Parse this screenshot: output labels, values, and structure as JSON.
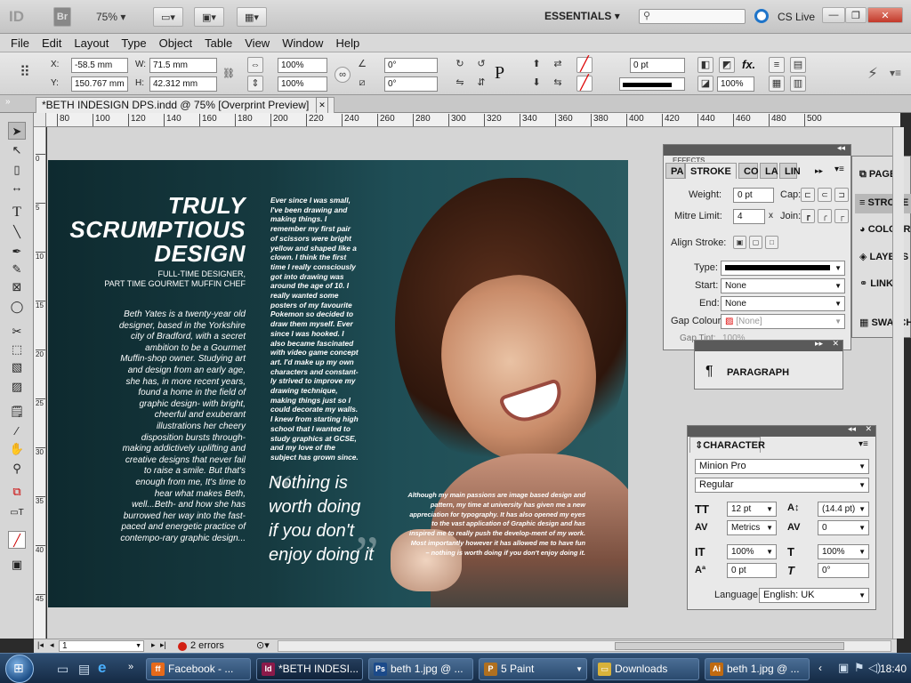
{
  "app": {
    "logo": "ID",
    "bridge": "Br",
    "zoom": "75%",
    "workspace": "ESSENTIALS",
    "cs_live": "CS Live"
  },
  "menu": [
    "File",
    "Edit",
    "Layout",
    "Type",
    "Object",
    "Table",
    "View",
    "Window",
    "Help"
  ],
  "control": {
    "x_label": "X:",
    "x_value": "-58.5 mm",
    "y_label": "Y:",
    "y_value": "150.767 mm",
    "w_label": "W:",
    "w_value": "71.5 mm",
    "h_label": "H:",
    "h_value": "42.312 mm",
    "scale_x": "100%",
    "scale_y": "100%",
    "angle1": "0°",
    "angle2": "0°",
    "stroke_weight": "0 pt",
    "opacity": "100%"
  },
  "doc_tab": "*BETH INDESIGN DPS.indd @ 75% [Overprint Preview]",
  "ruler_labels": [
    "80",
    "100",
    "120",
    "140",
    "160",
    "180",
    "200",
    "220",
    "240",
    "260",
    "280",
    "300",
    "320",
    "340",
    "360",
    "380",
    "400",
    "420",
    "440",
    "460",
    "480",
    "500"
  ],
  "vruler_labels": [
    "0",
    "5",
    "10",
    "15",
    "20",
    "25",
    "30",
    "35",
    "40",
    "45"
  ],
  "spread": {
    "title_lines": [
      "TRULY",
      "SCRUMPTIOUS",
      "DESIGN"
    ],
    "subtitle_lines": [
      "FULL-TIME DESIGNER,",
      "PART TIME GOURMET MUFFIN CHEF"
    ],
    "intro": "Beth Yates is a twenty-year old designer, based in the Yorkshire city of Bradford, with a secret ambition to be a Gourmet Muffin-shop owner. Studying art and design from an early age, she has, in more recent years, found a home in the field of graphic design- with bright, cheerful and exuberant illustrations her cheery disposition bursts through- making addictively uplifting and creative designs that never fail to raise a smile. But that's enough from me, It's time to hear what makes Beth, well...Beth- and how she has burrowed her way into the fast-paced and energetic practice of contempo-rary graphic design...",
    "column": "Ever since I was small, I've been drawing and making things. I remember my first pair of scissors were bright yellow and shaped like a clown. I think the first time I really consciously got into drawing was around the age of 10. I really wanted some posters of my favourite Pokemon so decided to draw them myself. Ever since I was hooked. I also became fascinated with video game concept art. I'd make up my own characters and constant-ly strived to improve my drawing technique, making things just so I could decorate my walls. I knew from starting high school that I wanted to study graphics at GCSE, and my love of the subject has grown since.",
    "quote_lines": [
      "Nothing is",
      "worth doing",
      "if you don't",
      "enjoy doing it"
    ],
    "caption": "Although my main passions are image based design and pattern, my time at university has given me a new appreciation for typography. It has also opened my eyes to the vast application of Graphic design and has inspired me to really push the develop-ment of my work. Most importantly however it has allowed me to have fun – nothing is worth doing if you don't enjoy doing it."
  },
  "stroke_panel": {
    "tabs": [
      "PA",
      "STROKE",
      "CO",
      "LA",
      "LIN"
    ],
    "effects_tab": "EFFECTS",
    "weight_label": "Weight:",
    "weight": "0 pt",
    "cap_label": "Cap:",
    "mitre_label": "Mitre Limit:",
    "mitre": "4",
    "x": "x",
    "join_label": "Join:",
    "align_label": "Align Stroke:",
    "type_label": "Type:",
    "start_label": "Start:",
    "start": "None",
    "end_label": "End:",
    "end": "None",
    "gap_colour_label": "Gap Colour:",
    "gap_colour": "[None]",
    "gap_tint_label": "Gap Tint:",
    "gap_tint": "100%"
  },
  "dock": [
    "PAGES",
    "STROKE",
    "COLOUR",
    "LAYERS",
    "LINKS",
    "SWATCHES"
  ],
  "paragraph_panel": {
    "title": "PARAGRAPH"
  },
  "character_panel": {
    "title": "CHARACTER",
    "font": "Minion Pro",
    "style": "Regular",
    "size": "12 pt",
    "leading": "(14.4 pt)",
    "kerning": "Metrics",
    "tracking": "0",
    "vscale": "100%",
    "hscale": "100%",
    "baseline": "0 pt",
    "skew": "0°",
    "language_label": "Language:",
    "language": "English: UK"
  },
  "status": {
    "page": "1",
    "errors": "2 errors"
  },
  "taskbar": {
    "items": [
      "Facebook - ...",
      "*BETH INDESI...",
      "beth 1.jpg @ ...",
      "5 Paint",
      "Downloads",
      "beth 1.jpg @ ..."
    ],
    "clock": "18:40"
  }
}
